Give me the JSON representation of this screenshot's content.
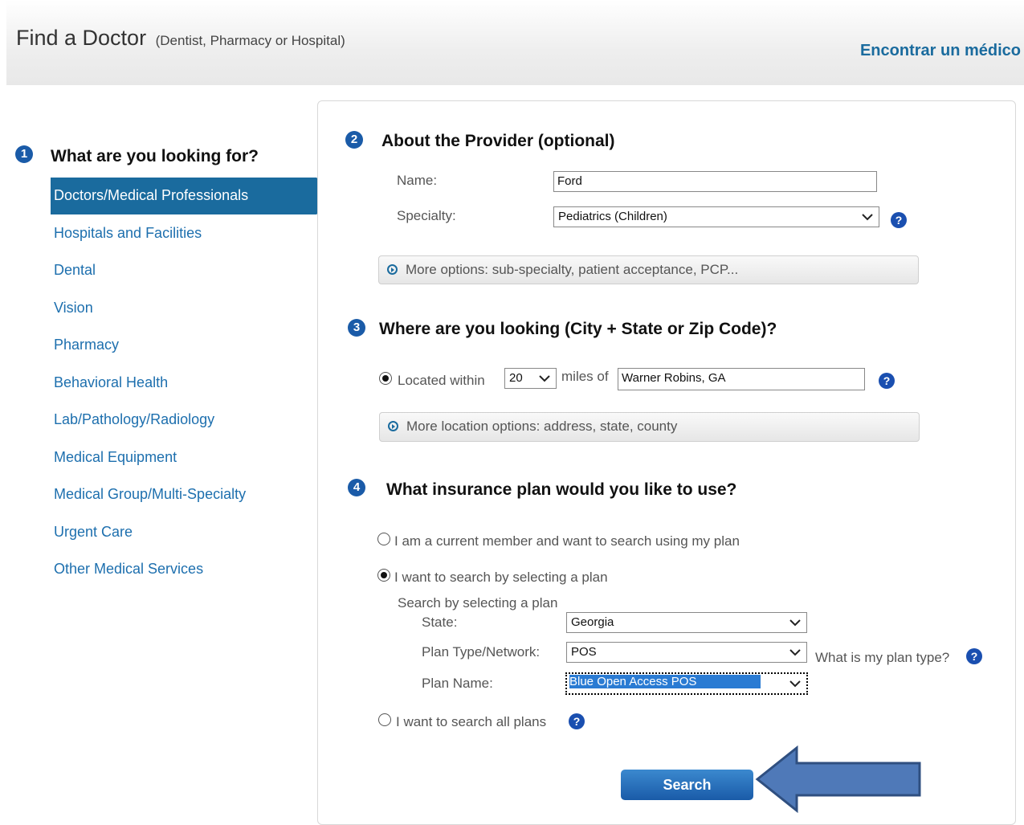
{
  "header": {
    "title": "Find a Doctor",
    "subtitle": "(Dentist, Pharmacy or Hospital)",
    "language_link": "Encontrar un médico"
  },
  "step1": {
    "number": "1",
    "title": "What are you looking for?",
    "items": [
      "Doctors/Medical Professionals",
      "Hospitals and Facilities",
      "Dental",
      "Vision",
      "Pharmacy",
      "Behavioral Health",
      "Lab/Pathology/Radiology",
      "Medical Equipment",
      "Medical Group/Multi-Specialty",
      "Urgent Care",
      "Other Medical Services"
    ]
  },
  "step2": {
    "number": "2",
    "title": "About the Provider (optional)",
    "name_label": "Name:",
    "name_value": "Ford",
    "specialty_label": "Specialty:",
    "specialty_value": "Pediatrics (Children)",
    "more_options": "More options: sub-specialty, patient acceptance, PCP..."
  },
  "step3": {
    "number": "3",
    "title": "Where are you looking (City + State or Zip Code)?",
    "located_within_label": "Located within",
    "miles_value": "20",
    "miles_of_label": "miles of",
    "location_value": "Warner Robins, GA",
    "more_location_options": "More location options: address, state, county"
  },
  "step4": {
    "number": "4",
    "title": "What insurance plan would you like to use?",
    "option_member": "I am a current member and want to search using my plan",
    "option_select": "I want to search by selecting a plan",
    "select_heading": "Search by selecting a plan",
    "state_label": "State:",
    "state_value": "Georgia",
    "plan_type_label": "Plan Type/Network:",
    "plan_type_value": "POS",
    "plan_type_help": "What is my plan type?",
    "plan_name_label": "Plan Name:",
    "plan_name_value": "Blue Open Access POS",
    "option_all": "I want to search all plans"
  },
  "search_button": "Search",
  "icons": {
    "help": "?",
    "chevron": "❯"
  }
}
